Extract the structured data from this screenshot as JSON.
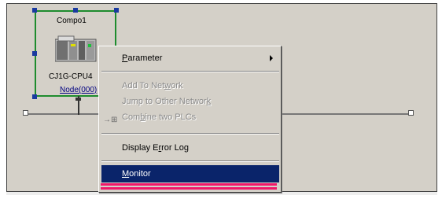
{
  "node": {
    "name": "Compo1",
    "model": "CJ1G-CPU4",
    "address": "Node(000)"
  },
  "menu": {
    "items": [
      {
        "label": "Parameter",
        "accel": "P",
        "enabled": true,
        "submenu": true
      },
      {
        "label": "Add To Network",
        "accel": "w",
        "enabled": false
      },
      {
        "label": "Jump to Other Network",
        "accel": "k",
        "enabled": false
      },
      {
        "label": "Combine two PLCs",
        "accel": "b",
        "enabled": false,
        "icon": "combine-icon"
      },
      {
        "label": "Display Error Log",
        "accel": "r",
        "enabled": true
      },
      {
        "label": "Monitor",
        "accel": "M",
        "enabled": true,
        "highlighted": true
      }
    ]
  },
  "colors": {
    "selection": "#1e8c2e",
    "handle": "#1a3aa0",
    "highlight": "#0a246a",
    "redmark": "#f0176a"
  }
}
